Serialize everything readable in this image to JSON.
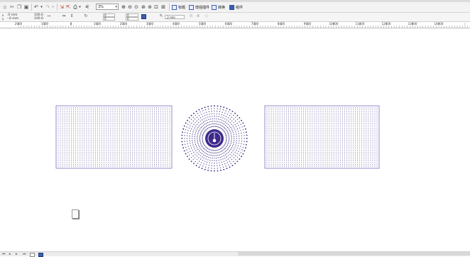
{
  "toolbar": {
    "icons": [
      "new-icon",
      "open-icon",
      "save-icon",
      "cut-icon",
      "copy-icon",
      "paste-icon",
      "undo-icon",
      "redo-icon",
      "import-icon",
      "export-icon",
      "print-icon",
      "snap-icon"
    ],
    "zoom_level": "3%",
    "buttons": [
      {
        "label": "标题"
      },
      {
        "label": "增强插件"
      },
      {
        "label": "转换"
      },
      {
        "label": "组件"
      }
    ]
  },
  "property_bar": {
    "x_value": ".0 mm",
    "y_value": "-.0 mm",
    "width_value": "100.0",
    "height_value": "100.0",
    "rotation_value": "0",
    "rotation2_value": "0",
    "outline_value": ".2 mm"
  },
  "ruler": {
    "labels": [
      "2000",
      "1000",
      "0",
      "1000",
      "2000",
      "3000",
      "4000",
      "5000",
      "6000",
      "7000",
      "8000",
      "9000",
      "10000",
      "11000",
      "12000",
      "13000",
      "14000"
    ]
  },
  "colors": {
    "accent": "#3f2a8c",
    "frame": "#7a6bc0",
    "dot": "#2f1f7a"
  }
}
